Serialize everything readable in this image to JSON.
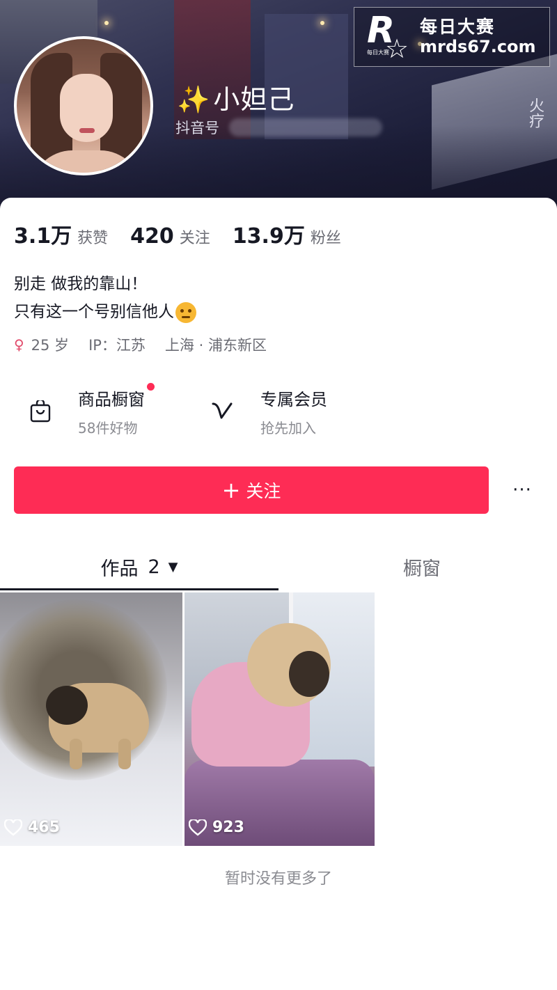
{
  "watermark": {
    "logo_letter": "R",
    "logo_small": "每日大赛",
    "title": "每日大赛",
    "url": "mrds67.com"
  },
  "banner": {
    "sign_text": "火疗"
  },
  "profile": {
    "sparkle": "✨",
    "nickname": "小妲己",
    "douyin_id_label": "抖音号",
    "stats": [
      {
        "value": "3.1万",
        "label": "获赞"
      },
      {
        "value": "420",
        "label": "关注"
      },
      {
        "value": "13.9万",
        "label": "粉丝"
      }
    ],
    "bio_line1": "别走 做我的靠山！",
    "bio_line2": "只有这一个号别信他人",
    "gender_symbol": "♀",
    "age": "25 岁",
    "ip": "IP：江苏",
    "location": "上海 · 浦东新区"
  },
  "services": [
    {
      "title": "商品橱窗",
      "subtitle": "58件好物",
      "icon": "shopping-bag-icon",
      "has_dot": true
    },
    {
      "title": "专属会员",
      "subtitle": "抢先加入",
      "icon": "vip-v-icon",
      "has_dot": false
    }
  ],
  "actions": {
    "follow_plus": "+",
    "follow_label": "关注",
    "more_label": "···"
  },
  "tabs": {
    "works_label": "作品",
    "works_count": "2",
    "works_caret": "▼",
    "window_label": "橱窗"
  },
  "videos": [
    {
      "likes": "465"
    },
    {
      "likes": "923"
    }
  ],
  "footer": {
    "no_more": "暂时没有更多了"
  },
  "colors": {
    "accent": "#fe2c55",
    "text_primary": "#161823",
    "text_secondary": "#6b6c74"
  }
}
